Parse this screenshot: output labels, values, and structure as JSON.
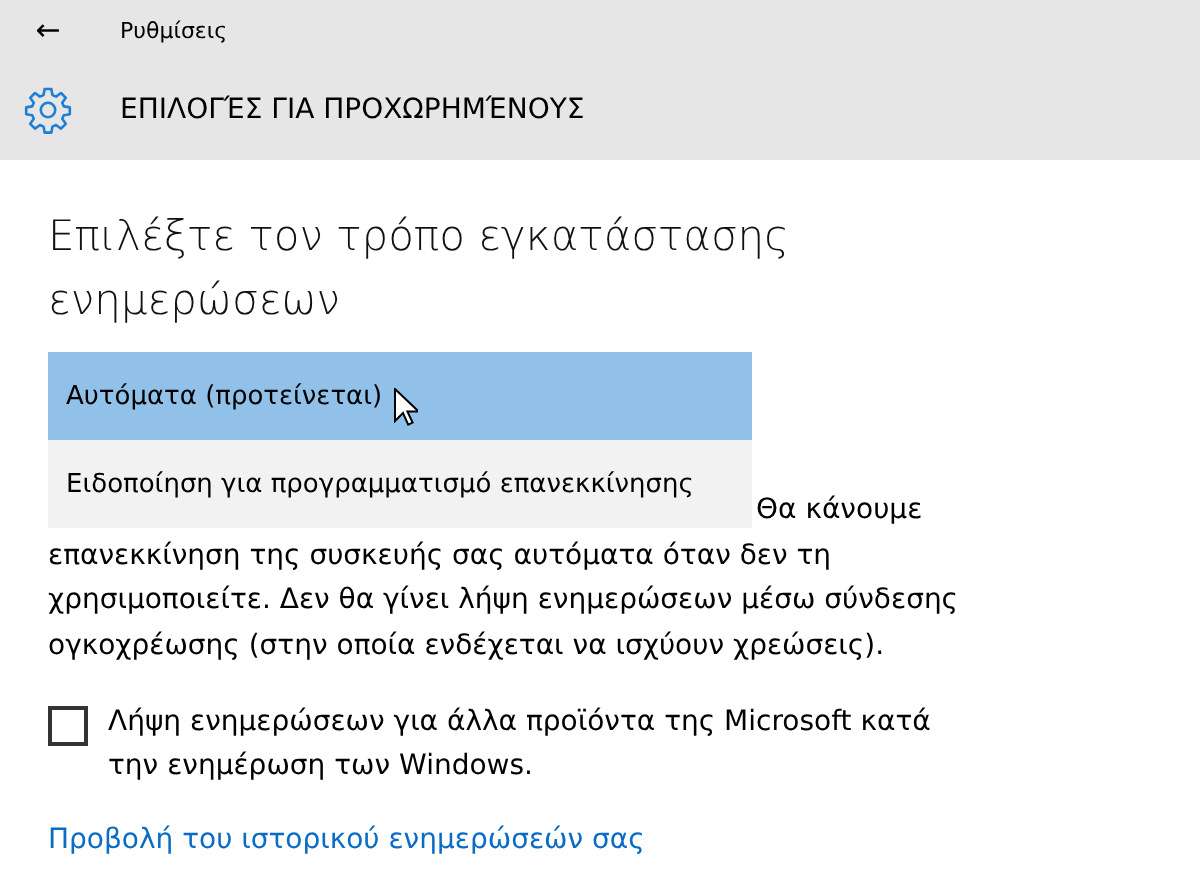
{
  "title_bar": {
    "back": "←",
    "title": "Ρυθμίσεις"
  },
  "header": {
    "title": "ΕΠΙΛΟΓΈΣ ΓΙΑ ΠΡΟΧΩΡΗΜΈΝΟΥΣ"
  },
  "heading": "Επιλέξτε τον τρόπο εγκατάστασης ενημερώσεων",
  "dropdown_options": [
    {
      "label": "Αυτόματα (προτείνεται)",
      "selected": true
    },
    {
      "label": "Ειδοποίηση για προγραμματισμό επανεκκίνησης",
      "selected": false
    }
  ],
  "description": "Θα κάνουμε επανεκκίνηση της συσκευής σας αυτόματα όταν δεν τη χρησιμοποιείτε. Δεν θα γίνει λήψη ενημερώσεων μέσω σύνδεσης ογκοχρέωσης (στην οποία ενδέχεται να ισχύουν χρεώσεις).",
  "checkbox": {
    "label": "Λήψη ενημερώσεων για άλλα προϊόντα της Microsoft κατά την ενημέρωση των Windows.",
    "checked": false
  },
  "link": "Προβολή του ιστορικού ενημερώσεών σας"
}
